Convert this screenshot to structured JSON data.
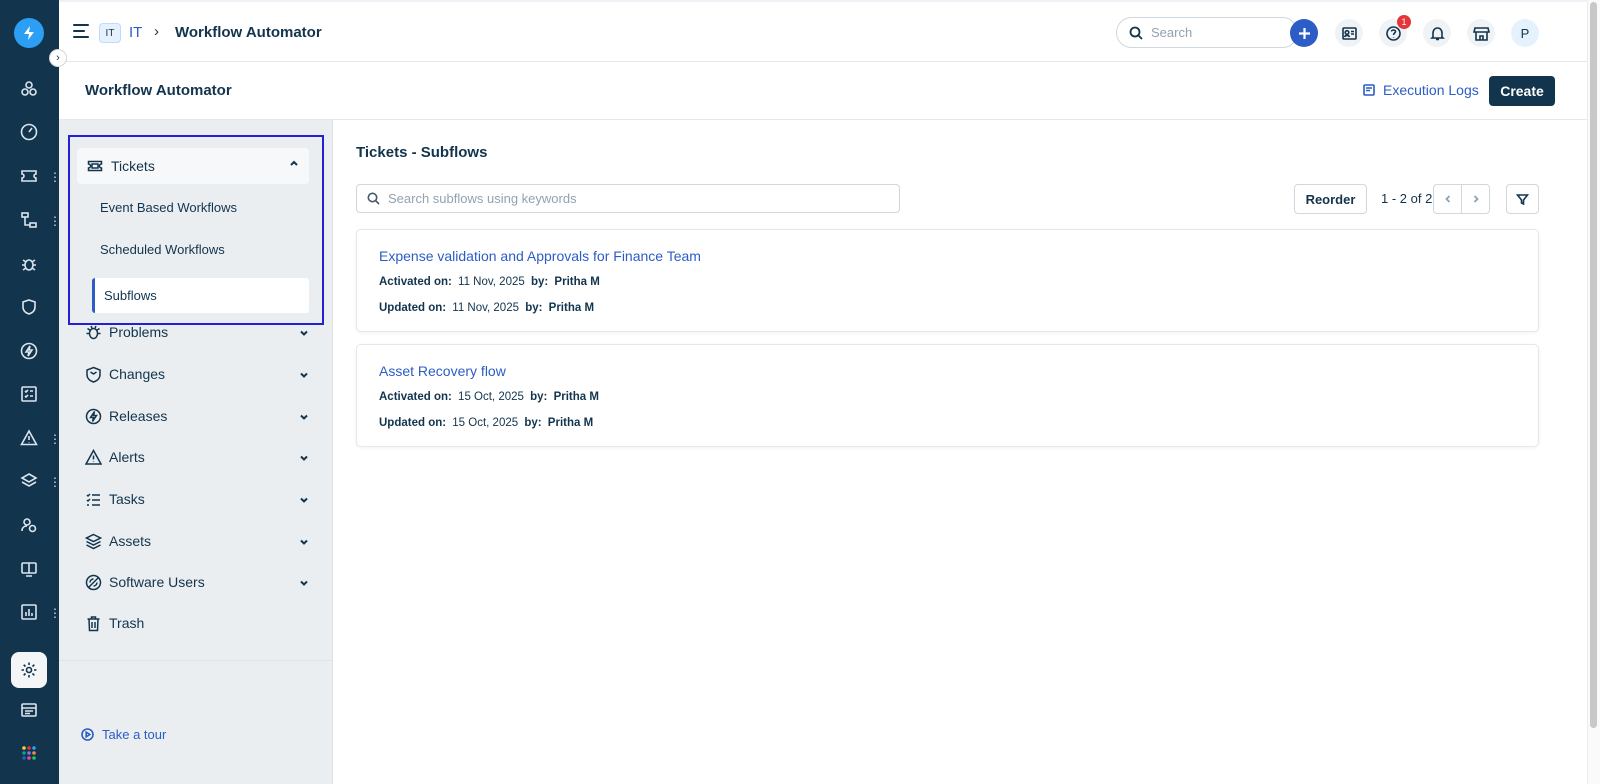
{
  "colors": {
    "rail_bg": "#12344d",
    "accent": "#2c5cc5",
    "brand": "#2c9ff5",
    "badge": "#e43538",
    "focus_outline": "#2320d6"
  },
  "topbar": {
    "workspace_badge": "IT",
    "workspace_name": "IT",
    "breadcrumb_sep": "›",
    "breadcrumb_title": "Workflow Automator",
    "search_placeholder": "Search",
    "help_badge_count": "1",
    "avatar_initial": "P"
  },
  "rail": {
    "icons": [
      "dashboard-icon",
      "speedometer-icon",
      "ticket-icon",
      "workflow-icon",
      "bug-icon",
      "shield-icon",
      "releases-icon",
      "tasks-icon",
      "alert-icon",
      "layers-icon",
      "users-icon",
      "book-icon",
      "analytics-icon",
      "settings-icon",
      "apps-icon",
      "grid-icon"
    ]
  },
  "header": {
    "title": "Workflow Automator",
    "execution_logs": "Execution Logs",
    "create": "Create"
  },
  "sidenav": {
    "tickets": {
      "label": "Tickets",
      "children": [
        "Event Based Workflows",
        "Scheduled Workflows",
        "Subflows"
      ],
      "active": "Subflows"
    },
    "items": [
      {
        "label": "Problems",
        "icon": "bug-icon"
      },
      {
        "label": "Changes",
        "icon": "shield-icon"
      },
      {
        "label": "Releases",
        "icon": "releases-icon"
      },
      {
        "label": "Alerts",
        "icon": "alert-icon"
      },
      {
        "label": "Tasks",
        "icon": "tasks-icon"
      },
      {
        "label": "Assets",
        "icon": "layers-icon"
      },
      {
        "label": "Software Users",
        "icon": "software-icon"
      },
      {
        "label": "Trash",
        "icon": "trash-icon"
      }
    ],
    "tour": "Take a tour"
  },
  "main": {
    "title": "Tickets - Subflows",
    "search_placeholder": "Search subflows using keywords",
    "reorder": "Reorder",
    "pagination": "1 - 2 of 2",
    "subflows": [
      {
        "name": "Expense validation and Approvals for Finance Team",
        "activated_label": "Activated on:",
        "activated_date": "11 Nov, 2025",
        "activated_by_label": "by:",
        "activated_by": "Pritha M",
        "updated_label": "Updated on:",
        "updated_date": "11 Nov, 2025",
        "updated_by_label": "by:",
        "updated_by": "Pritha M"
      },
      {
        "name": "Asset Recovery flow",
        "activated_label": "Activated on:",
        "activated_date": "15 Oct, 2025",
        "activated_by_label": "by:",
        "activated_by": "Pritha M",
        "updated_label": "Updated on:",
        "updated_date": "15 Oct, 2025",
        "updated_by_label": "by:",
        "updated_by": "Pritha M"
      }
    ]
  }
}
